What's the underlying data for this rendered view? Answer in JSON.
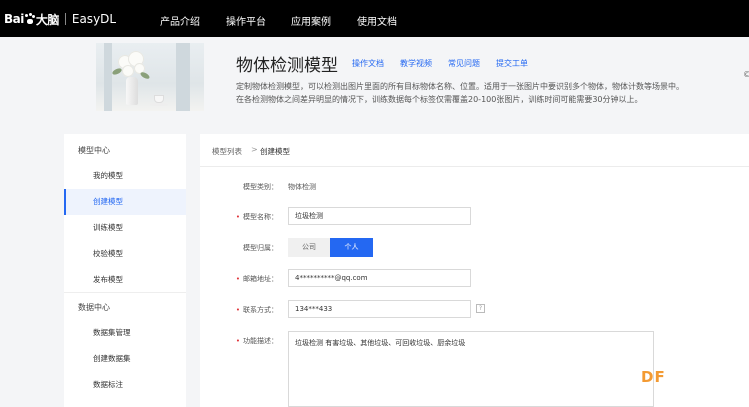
{
  "brand": {
    "logo_text": "Bai",
    "logo_cn": "大脑",
    "product": "EasyDL"
  },
  "topnav": {
    "items": [
      "产品介绍",
      "操作平台",
      "应用案例",
      "使用文档"
    ]
  },
  "banner": {
    "title": "物体检测模型",
    "links": [
      "操作文档",
      "教学视频",
      "常见问题",
      "提交工单"
    ],
    "desc_line1": "定制物体检测模型，可以检测出图片里面的所有目标物体名称、位置。适用于一张图片中要识别多个物体，物体计数等场景中。",
    "desc_line2": "在各检测物体之间差异明显的情况下，训练数据每个标签仅需覆盖20-100张图片，训练时间可能需要30分钟以上。",
    "edge_mark": "©"
  },
  "sidebar": {
    "group1": "模型中心",
    "group1_items": [
      "我的模型",
      "创建模型",
      "训练模型",
      "校验模型",
      "发布模型"
    ],
    "active_item": "创建模型",
    "group2": "数据中心",
    "group2_items": [
      "数据集管理",
      "创建数据集",
      "数据标注"
    ]
  },
  "breadcrumb": {
    "parent": "模型列表",
    "separator": ">",
    "current": "创建模型"
  },
  "form": {
    "category_label": "模型类别：",
    "category_value": "物体检测",
    "name_label": "模型名称：",
    "name_value": "垃圾检测",
    "owner_label": "模型归属：",
    "owner_options": [
      "公司",
      "个人"
    ],
    "owner_selected": "个人",
    "email_label": "邮箱地址：",
    "email_value": "4**********@qq.com",
    "phone_label": "联系方式：",
    "phone_value": "134***433",
    "help_symbol": "?",
    "desc_label": "功能描述：",
    "desc_value": "垃圾检测 有害垃圾、其他垃圾、可回收垃圾、厨余垃圾"
  },
  "watermark": "DF",
  "colors": {
    "accent": "#2468f2",
    "required": "#e0343a",
    "nav_bg": "#000000",
    "watermark": "#f39a32"
  }
}
